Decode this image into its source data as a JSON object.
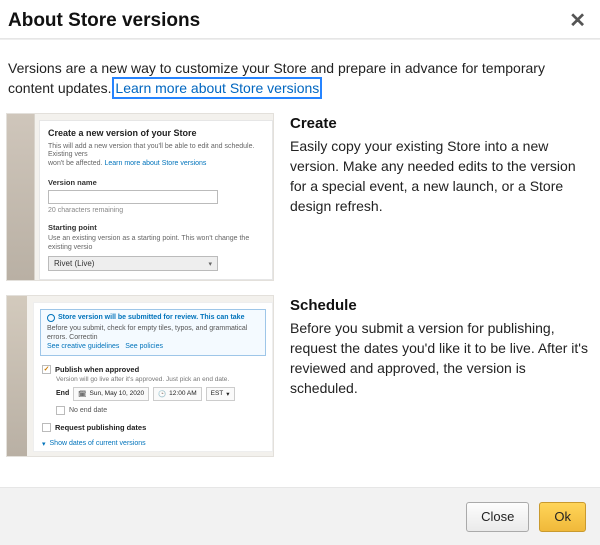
{
  "title": "About Store versions",
  "intro": {
    "text_before": "Versions are a new way to customize your Store and prepare in advance for temporary content updates. ",
    "link_label": "Learn more about Store versions"
  },
  "sections": {
    "create": {
      "heading": "Create",
      "body": "Easily copy your existing Store into a new version. Make any needed edits to the version for a special event, a new launch, or a Store design refresh."
    },
    "schedule": {
      "heading": "Schedule",
      "body": "Before you submit a version for publishing, request the dates you'd like it to be live. After it's reviewed and approved, the version is scheduled."
    }
  },
  "thumb_create": {
    "panel_title": "Create a new version of your Store",
    "panel_desc": "This will add a new version that you'll be able to edit and schedule. Existing vers",
    "panel_desc2": "won't be affected.",
    "panel_link": "Learn more about Store versions",
    "version_name_label": "Version name",
    "char_remaining": "20 characters remaining",
    "starting_point_label": "Starting point",
    "starting_point_desc": "Use an existing version as a starting point. This won't change the existing versio",
    "select_value": "Rivet (Live)"
  },
  "thumb_schedule": {
    "info_title": "Store version will be submitted for review. This can take",
    "info_body": "Before you submit, check for empty tiles, typos, and grammatical errors. Correctin",
    "info_link1": "See creative guidelines",
    "info_link2": "See policies",
    "publish_label": "Publish when approved",
    "publish_help": "Version will go live after it's approved. Just pick an end date.",
    "end_label": "End",
    "end_date": "Sun, May 10, 2020",
    "end_time": "12:00 AM",
    "end_tz": "EST",
    "no_end_label": "No end date",
    "request_label": "Request publishing dates",
    "disclosure": "Show dates of current versions"
  },
  "footer": {
    "close_label": "Close",
    "ok_label": "Ok"
  }
}
